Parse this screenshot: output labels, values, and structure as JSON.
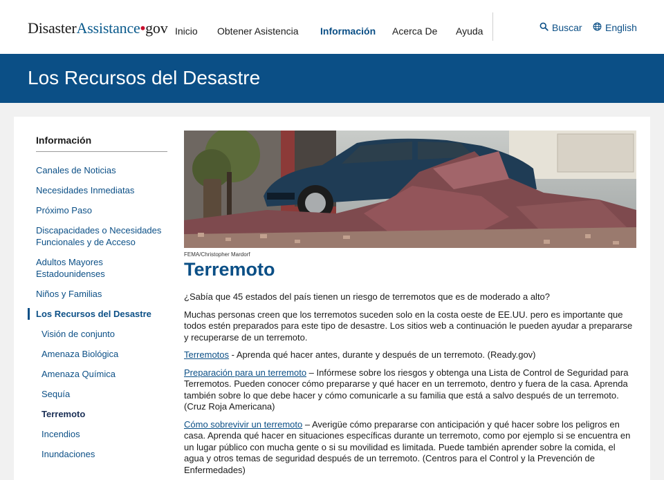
{
  "header": {
    "logo_part1": "Disaster",
    "logo_part2": "Assistance",
    "logo_dot": "•",
    "logo_part3": "gov",
    "nav": [
      "Inicio",
      "Obtener Asistencia",
      "Información",
      "Acerca De",
      "Ayuda"
    ],
    "active_nav": "Información",
    "search_label": "Buscar",
    "language_label": "English",
    "search_icon": "search-icon",
    "language_icon": "globe-icon"
  },
  "banner": {
    "title": "Los Recursos del Desastre"
  },
  "sidebar": {
    "title": "Información",
    "items": [
      "Canales de Noticias",
      "Necesidades Inmediatas",
      "Próximo Paso",
      "Discapacidades o Necesidades Funcionales y de Acceso",
      "Adultos Mayores Estadounidenses",
      "Niños y Familias",
      "Los Recursos del Desastre"
    ],
    "subitems": [
      "Visión de conjunto",
      "Amenaza Biológica",
      "Amenaza Química",
      "Sequía",
      "Terremoto",
      "Incendios",
      "Inundaciones"
    ]
  },
  "main": {
    "image_credit": "FEMA/Christopher Mardorf",
    "title": "Terremoto",
    "intro": "¿Sabía que 45 estados del país tienen un riesgo de terremotos que es de moderado a alto?",
    "paragraph2": "Muchas personas creen que los terremotos suceden solo en la costa oeste de EE.UU. pero es importante que todos estén preparados para este tipo de desastre. Los sitios web a continuación le pueden ayudar a prepararse y recuperarse de un terremoto.",
    "resources": [
      {
        "link": "Terremotos",
        "text": " - Aprenda qué hacer antes, durante y después de un terremoto. (Ready.gov)"
      },
      {
        "link": "Preparación para un terremoto",
        "text": " – Infórmese sobre los riesgos y obtenga una Lista de Control de Seguridad para Terremotos. Pueden conocer cómo prepararse y qué hacer en un terremoto, dentro y fuera de la casa. Aprenda también sobre lo que debe hacer y cómo comunicarle a su familia que está a salvo después de un terremoto. (Cruz Roja Americana)"
      },
      {
        "link": "Cómo sobrevivir un terremoto",
        "text": " – Averigüe cómo prepararse con anticipación y qué hacer sobre los peligros en casa. Aprenda qué hacer en situaciones específicas durante un terremoto, como por ejemplo si se encuentra en un lugar público con mucha gente o si su movilidad es limitada. Puede también aprender sobre la comida, el agua y otros temas de seguridad después de un terremoto. (Centros para el Control y la Prevención de Enfermedades)"
      }
    ]
  },
  "colors": {
    "brand_blue": "#0b4f86",
    "logo_red": "#c8102e",
    "background": "#f1f1f1"
  }
}
